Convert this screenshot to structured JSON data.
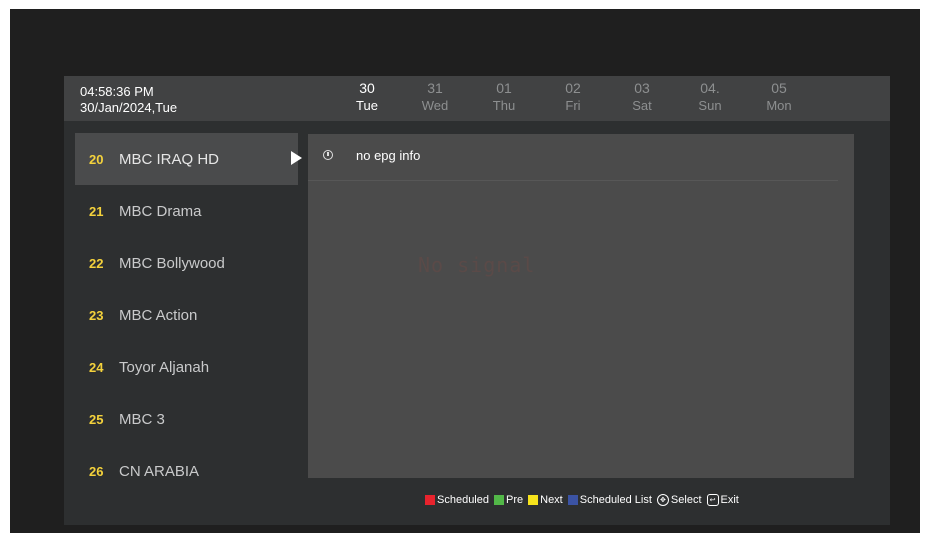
{
  "header": {
    "time": "04:58:36 PM",
    "date": "30/Jan/2024,Tue",
    "days": [
      {
        "num": "30",
        "name": "Tue"
      },
      {
        "num": "31",
        "name": "Wed"
      },
      {
        "num": "01",
        "name": "Thu"
      },
      {
        "num": "02",
        "name": "Fri"
      },
      {
        "num": "03",
        "name": "Sat"
      },
      {
        "num": "04.",
        "name": "Sun"
      },
      {
        "num": "05",
        "name": "Mon"
      }
    ]
  },
  "channels": [
    {
      "num": "20",
      "name": "MBC IRAQ HD"
    },
    {
      "num": "21",
      "name": "MBC Drama"
    },
    {
      "num": "22",
      "name": "MBC Bollywood"
    },
    {
      "num": "23",
      "name": "MBC Action"
    },
    {
      "num": "24",
      "name": "Toyor Aljanah"
    },
    {
      "num": "25",
      "name": "MBC 3"
    },
    {
      "num": "26",
      "name": "CN ARABIA"
    }
  ],
  "epg": {
    "entry": "no epg info",
    "overlay": "No signal"
  },
  "legend": {
    "red": "Scheduled",
    "green": "Pre",
    "yellow": "Next",
    "blue": "Scheduled List",
    "select": "Select",
    "exit": "Exit"
  },
  "colors": {
    "red": "#e8232d",
    "green": "#52b848",
    "yellow": "#f6e31c",
    "blue": "#3b53a4",
    "channel_number": "#f4d23c"
  }
}
